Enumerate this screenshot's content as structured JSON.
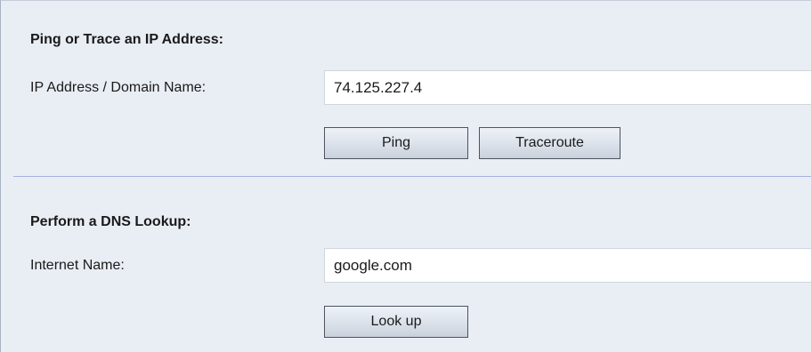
{
  "ping_section": {
    "title": "Ping or Trace an IP Address:",
    "address_label": "IP Address / Domain Name:",
    "address_value": "74.125.227.4",
    "ping_button": "Ping",
    "traceroute_button": "Traceroute"
  },
  "dns_section": {
    "title": "Perform a DNS Lookup:",
    "name_label": "Internet Name:",
    "name_value": "google.com",
    "lookup_button": "Look up"
  }
}
